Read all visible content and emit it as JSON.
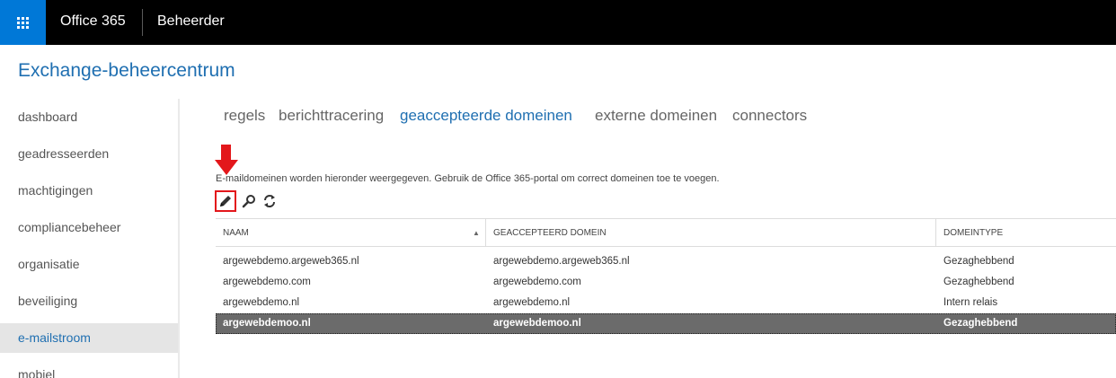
{
  "topbar": {
    "brand": "Office 365",
    "role": "Beheerder"
  },
  "page_title": "Exchange-beheercentrum",
  "sidebar": {
    "items": [
      {
        "label": "dashboard"
      },
      {
        "label": "geadresseerden"
      },
      {
        "label": "machtigingen"
      },
      {
        "label": "compliancebeheer"
      },
      {
        "label": "organisatie"
      },
      {
        "label": "beveiliging"
      },
      {
        "label": "e-mailstroom",
        "active": true
      },
      {
        "label": "mobiel"
      }
    ]
  },
  "tabs": [
    {
      "label": "regels"
    },
    {
      "label": "berichttracering"
    },
    {
      "label": "geaccepteerde domeinen",
      "active": true
    },
    {
      "label": "externe domeinen"
    },
    {
      "label": "connectors"
    }
  ],
  "info_text": "E-maildomeinen worden hieronder weergegeven. Gebruik de Office 365-portal om correct domeinen toe te voegen.",
  "toolbar": {
    "icons": [
      "edit-pencil-icon",
      "search-icon",
      "refresh-icon"
    ]
  },
  "table": {
    "columns": [
      "NAAM",
      "GEACCEPTEERD DOMEIN",
      "DOMEINTYPE"
    ],
    "sort_indicator": "▲",
    "rows": [
      {
        "naam": "argewebdemo.argeweb365.nl",
        "domein": "argewebdemo.argeweb365.nl",
        "type": "Gezaghebbend"
      },
      {
        "naam": "argewebdemo.com",
        "domein": "argewebdemo.com",
        "type": "Gezaghebbend"
      },
      {
        "naam": "argewebdemo.nl",
        "domein": "argewebdemo.nl",
        "type": "Intern relais"
      },
      {
        "naam": "argewebdemoo.nl",
        "domein": "argewebdemoo.nl",
        "type": "Gezaghebbend",
        "selected": true
      }
    ]
  },
  "colors": {
    "accent": "#0078d7",
    "link_blue": "#1f6fb1",
    "annotation_red": "#e3171b",
    "selected_row": "#6b6b6b"
  }
}
